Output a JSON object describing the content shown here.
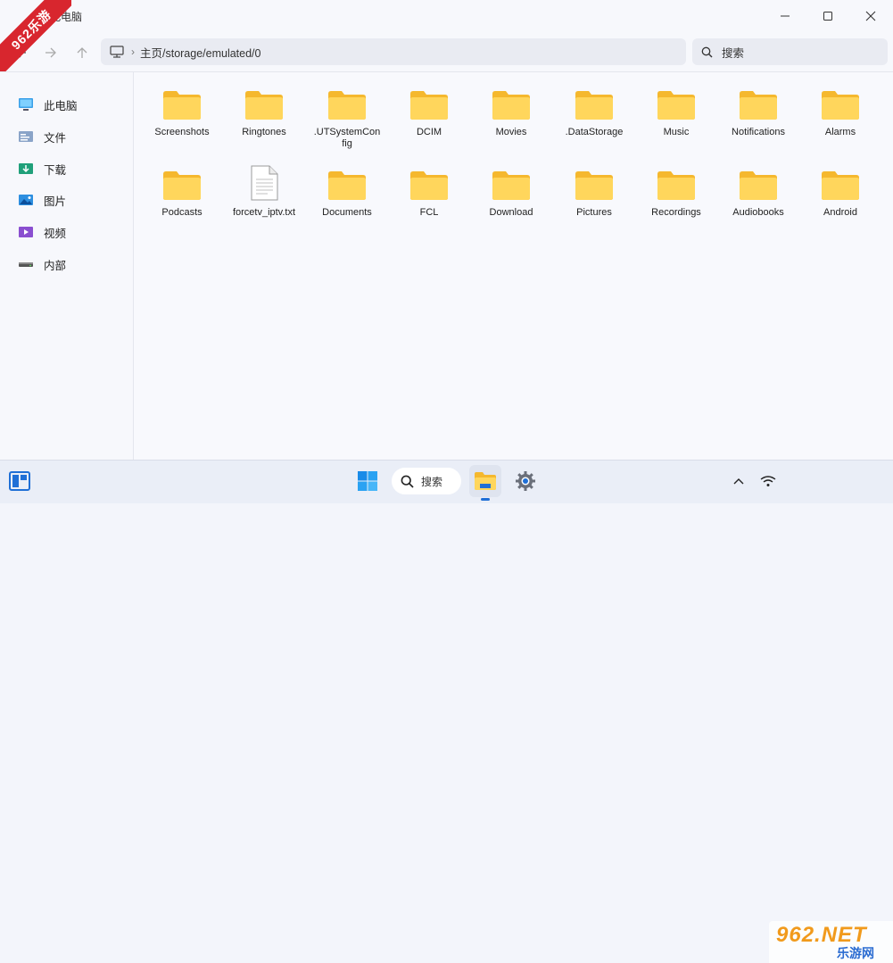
{
  "window": {
    "title": "此电脑"
  },
  "nav": {
    "address_path": "主页/storage/emulated/0",
    "search_placeholder": "搜索"
  },
  "sidebar": {
    "items": [
      {
        "label": "此电脑",
        "icon": "computer-icon"
      },
      {
        "label": "文件",
        "icon": "document-icon"
      },
      {
        "label": "下载",
        "icon": "download-icon"
      },
      {
        "label": "图片",
        "icon": "pictures-icon"
      },
      {
        "label": "视频",
        "icon": "video-icon"
      },
      {
        "label": "内部",
        "icon": "drive-icon"
      }
    ]
  },
  "files": [
    {
      "name": "Screenshots",
      "type": "folder"
    },
    {
      "name": "Ringtones",
      "type": "folder"
    },
    {
      "name": ".UTSystemConfig",
      "type": "folder"
    },
    {
      "name": "DCIM",
      "type": "folder"
    },
    {
      "name": "Movies",
      "type": "folder"
    },
    {
      "name": ".DataStorage",
      "type": "folder"
    },
    {
      "name": "Music",
      "type": "folder"
    },
    {
      "name": "Notifications",
      "type": "folder"
    },
    {
      "name": "Alarms",
      "type": "folder"
    },
    {
      "name": "Podcasts",
      "type": "folder"
    },
    {
      "name": "forcetv_iptv.txt",
      "type": "file"
    },
    {
      "name": "Documents",
      "type": "folder"
    },
    {
      "name": "FCL",
      "type": "folder"
    },
    {
      "name": "Download",
      "type": "folder"
    },
    {
      "name": "Pictures",
      "type": "folder"
    },
    {
      "name": "Recordings",
      "type": "folder"
    },
    {
      "name": "Audiobooks",
      "type": "folder"
    },
    {
      "name": "Android",
      "type": "folder"
    }
  ],
  "taskbar": {
    "search_label": "搜索"
  },
  "watermark": {
    "corner_text": "962乐游",
    "logo_text": "962.NET",
    "logo_sub": "乐游网"
  },
  "colors": {
    "accent": "#1f6fd6",
    "folder_light": "#ffd65c",
    "folder_dark": "#f5b82e",
    "watermark_red": "#d8262e"
  }
}
